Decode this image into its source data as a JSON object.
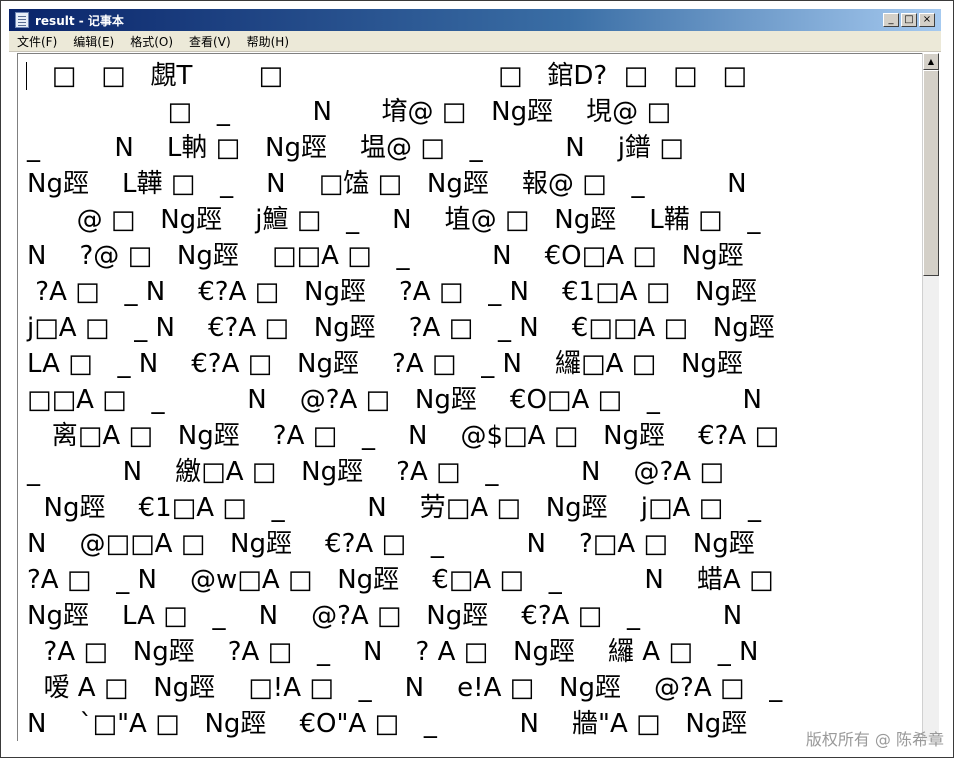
{
  "window": {
    "title": "result - 记事本",
    "buttons": {
      "minimize": "_",
      "maximize": "□",
      "close": "×"
    }
  },
  "menu": [
    {
      "label": "文件(F)"
    },
    {
      "label": "编辑(E)"
    },
    {
      "label": "格式(O)"
    },
    {
      "label": "查看(V)"
    },
    {
      "label": "帮助(H)"
    }
  ],
  "document": {
    "lines": [
      "   □   □   覷T        □                          □   錧D?  □   □   □",
      "                 □   _          N      堉@ □   Ng踁    垷@ □",
      "_         N    L軜 □   Ng踁    塭@ □   _          N    j鐠 □",
      "Ng踁    L韡 □   _    N    □馌 □   Ng踁    報@ □   _          N",
      "      @ □   Ng踁    j鱣 □   _    N    埴@ □   Ng踁    L鞴 □   _",
      "N    ?@ □   Ng踁    □□A □   _          N    €O□A □   Ng踁",
      " ?A □   _ N    €?A □   Ng踁    ?A □   _ N    €1□A □   Ng踁",
      "j□A □   _ N    €?A □   Ng踁    ?A □   _ N    €□□A □   Ng踁",
      "LA □   _ N    €?A □   Ng踁    ?A □   _ N    纙□A □   Ng踁",
      "□□A □   _          N    @?A □   Ng踁    €O□A □   _          N",
      "   离□A □   Ng踁    ?A □   _    N    @$□A □   Ng踁    €?A □",
      "_          N    繳□A □   Ng踁    ?A □   _          N    @?A □",
      "  Ng踁    €1□A □   _          N    劳□A □   Ng踁    j□A □   _",
      "N    @□□A □   Ng踁    €?A □   _          N    ?□A □   Ng踁",
      "?A □   _ N    @w□A □   Ng踁    €□A □   _          N    蜡A □",
      "Ng踁    LA □   _    N    @?A □   Ng踁    €?A □   _          N",
      "  ?A □   Ng踁    ?A □   _    N    ? A □   Ng踁    纙 A □   _ N",
      "  嗳 A □   Ng踁    □!A □   _    N    e!A □   Ng踁    @?A □   _",
      "N    `□\"A □   Ng踁    €O\"A □   _          N    牆\"A □   Ng踁"
    ]
  },
  "watermark": "版权所有 @ 陈希章"
}
